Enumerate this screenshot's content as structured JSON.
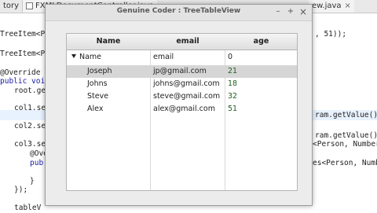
{
  "ide": {
    "tabs": [
      "tory",
      "FXMLDocumentController.java",
      "ew.java"
    ],
    "code": [
      "TreeItem<Person> ",
      "TreeItem<Pe",
      "@Override",
      "public void",
      "root.ge",
      "col1.se",
      "col2.se",
      "col3.se",
      "@Ove",
      "pub",
      "}",
      "});",
      "tableV",
      ", 51));",
      "ram.getValue().",
      "ram.getValue().",
      "<Person, Number",
      "es<Person, Numb"
    ]
  },
  "window": {
    "title": "Genuine Coder : TreeTableView",
    "minimize": "–",
    "maximize": "+",
    "close": "×"
  },
  "table": {
    "columns": [
      "Name",
      "email",
      "age"
    ],
    "root": {
      "name": "Name",
      "email": "email",
      "age": "0"
    },
    "rows": [
      {
        "name": "Joseph",
        "email": "jp@gmail.com",
        "age": "21"
      },
      {
        "name": "Johns",
        "email": "johns@gmail.com",
        "age": "18"
      },
      {
        "name": "Steve",
        "email": "steve@gmail.com",
        "age": "32"
      },
      {
        "name": "Alex",
        "email": "alex@gmail.com",
        "age": "51"
      }
    ]
  }
}
